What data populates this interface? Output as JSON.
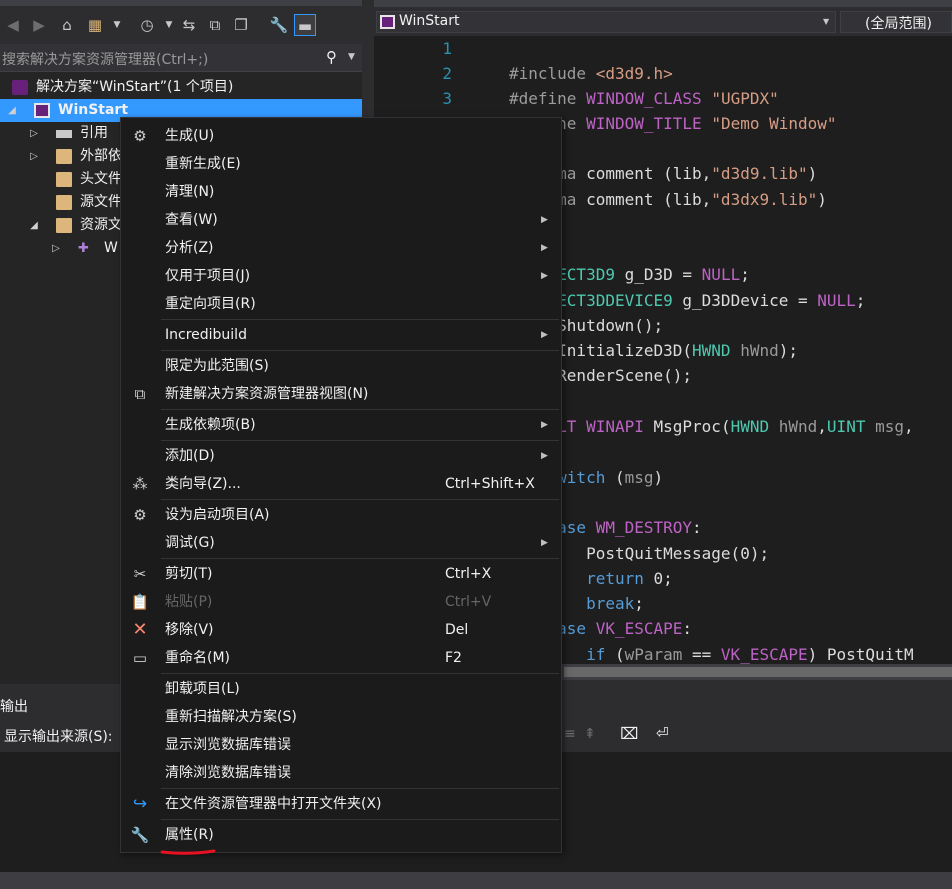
{
  "solution_explorer": {
    "search_placeholder": "搜索解决方案资源管理器(Ctrl+;)",
    "tree": {
      "solution": "解决方案“WinStart”(1 个项目)",
      "project": "WinStart",
      "references": "引用",
      "external_deps": "外部依",
      "header_files": "头文件",
      "source_files": "源文件",
      "resource_files": "资源文",
      "resource_child": "W"
    }
  },
  "editor": {
    "nav_project": "WinStart",
    "nav_scope": "(全局范围)",
    "line_numbers": [
      "1",
      "2",
      "3"
    ]
  },
  "output": {
    "title": "输出",
    "source_label": "显示输出来源(S):"
  },
  "context_menu": {
    "build": "生成(U)",
    "rebuild": "重新生成(E)",
    "clean": "清理(N)",
    "view": "查看(W)",
    "analyze": "分析(Z)",
    "project_only": "仅用于项目(J)",
    "retarget": "重定向项目(R)",
    "incredibuild": "Incredibuild",
    "scope_to_this": "限定为此范围(S)",
    "new_se_view": "新建解决方案资源管理器视图(N)",
    "build_dependencies": "生成依赖项(B)",
    "add": "添加(D)",
    "class_wizard": "类向导(Z)...",
    "class_wizard_shortcut": "Ctrl+Shift+X",
    "set_startup": "设为启动项目(A)",
    "debug": "调试(G)",
    "cut": "剪切(T)",
    "cut_shortcut": "Ctrl+X",
    "paste": "粘贴(P)",
    "paste_shortcut": "Ctrl+V",
    "remove": "移除(V)",
    "remove_shortcut": "Del",
    "rename": "重命名(M)",
    "rename_shortcut": "F2",
    "unload": "卸载项目(L)",
    "rescan": "重新扫描解决方案(S)",
    "show_browse_errors": "显示浏览数据库错误",
    "clear_browse_errors": "清除浏览数据库错误",
    "open_in_explorer": "在文件资源管理器中打开文件夹(X)",
    "properties": "属性(R)"
  },
  "colors": {
    "selection": "#3399ff",
    "annotation_red": "#e81123"
  }
}
